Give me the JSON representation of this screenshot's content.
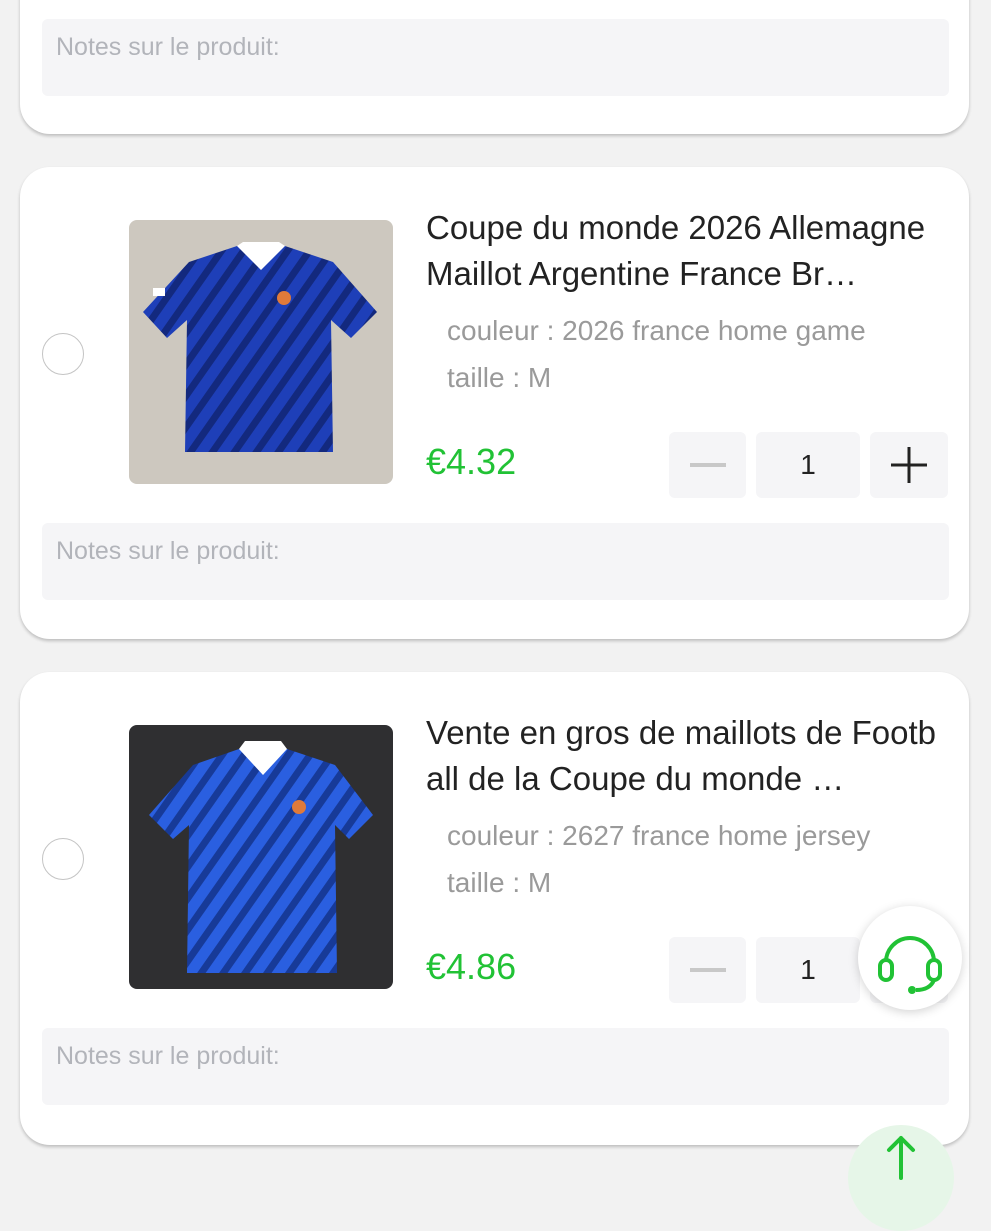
{
  "notes_placeholder": "Notes sur le produit:",
  "products": [
    {
      "title": "Coupe du monde 2026 Allemagne Maillot Argentine France Br…",
      "color_label": "couleur : 2026 france home game",
      "size_label": "taille : M",
      "price": "€4.32",
      "quantity": "1",
      "image_icon": "jersey-image"
    },
    {
      "title": "Vente en gros de maillots de Football de la Coupe du monde …",
      "color_label": "couleur : 2627 france home jersey",
      "size_label": "taille : M",
      "price": "€4.86",
      "quantity": "1",
      "image_icon": "jersey-image"
    }
  ],
  "icons": {
    "minus": "minus-icon",
    "plus": "plus-icon",
    "support": "headset-icon",
    "back_to_top": "arrow-up-icon"
  },
  "colors": {
    "price": "#21c235",
    "accent": "#21c235"
  }
}
